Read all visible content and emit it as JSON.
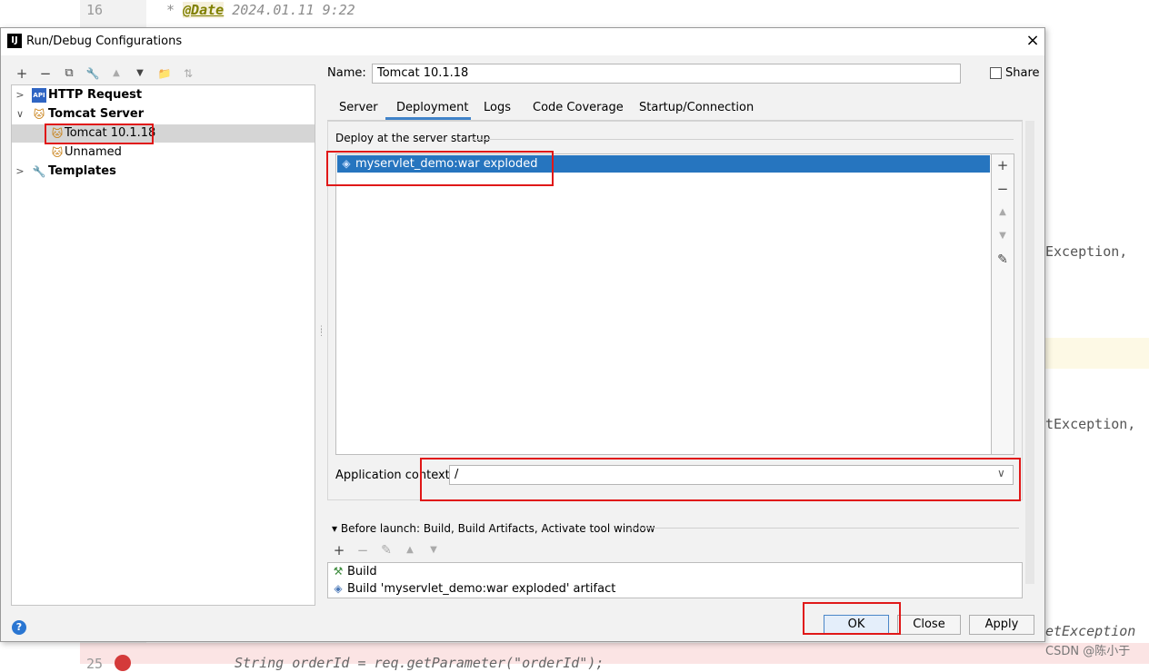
{
  "editor": {
    "line_top": "16",
    "line_bottom": "25",
    "code_top_prefix": "* ",
    "code_top_tag": "@Date",
    "code_top_value": " 2024.01.11 9:22",
    "exc1": "Exception,",
    "exc2": "tException,",
    "exc3": "etException",
    "code_bottom": "String orderId = req.getParameter(\"orderId\");",
    "watermark": "CSDN @陈小于"
  },
  "dialog": {
    "app_icon": "IJ",
    "title": "Run/Debug Configurations",
    "close_icon": "×"
  },
  "toolbar": {
    "add": "+",
    "remove": "−",
    "copy": "⧉",
    "edit": "🔧",
    "up": "▲",
    "down": "▼",
    "folder": "📁",
    "sort": "⇅"
  },
  "tree": {
    "http_request": "HTTP Request",
    "tomcat_server": "Tomcat Server",
    "tomcat_config": "Tomcat 10.1.18",
    "unnamed": "Unnamed",
    "templates": "Templates",
    "api_icon_text": "API"
  },
  "name_field": {
    "label": "Name:",
    "value": "Tomcat 10.1.18"
  },
  "share": {
    "label": "Share"
  },
  "tabs": [
    {
      "label": "Server"
    },
    {
      "label": "Deployment"
    },
    {
      "label": "Logs"
    },
    {
      "label": "Code Coverage"
    },
    {
      "label": "Startup/Connection"
    }
  ],
  "active_tab": "Deployment",
  "deployment": {
    "group_title": "Deploy at the server startup",
    "items": [
      "myservlet_demo:war exploded"
    ],
    "side_buttons": {
      "add": "+",
      "remove": "−",
      "up": "▲",
      "down": "▼",
      "edit": "✎"
    },
    "app_context_label": "Application context:",
    "app_context_value": "/"
  },
  "before_launch": {
    "title": "Before launch: Build, Build Artifacts, Activate tool window",
    "buttons": {
      "add": "+",
      "remove": "−",
      "edit": "✎",
      "up": "▲",
      "down": "▼"
    },
    "items": [
      "Build",
      "Build 'myservlet_demo:war exploded' artifact"
    ]
  },
  "buttons": {
    "help": "?",
    "ok": "OK",
    "close": "Close",
    "apply": "Apply"
  },
  "colors": {
    "selection_blue": "#2675bf",
    "highlight_red": "#e01818",
    "tab_underline": "#4083c9"
  }
}
